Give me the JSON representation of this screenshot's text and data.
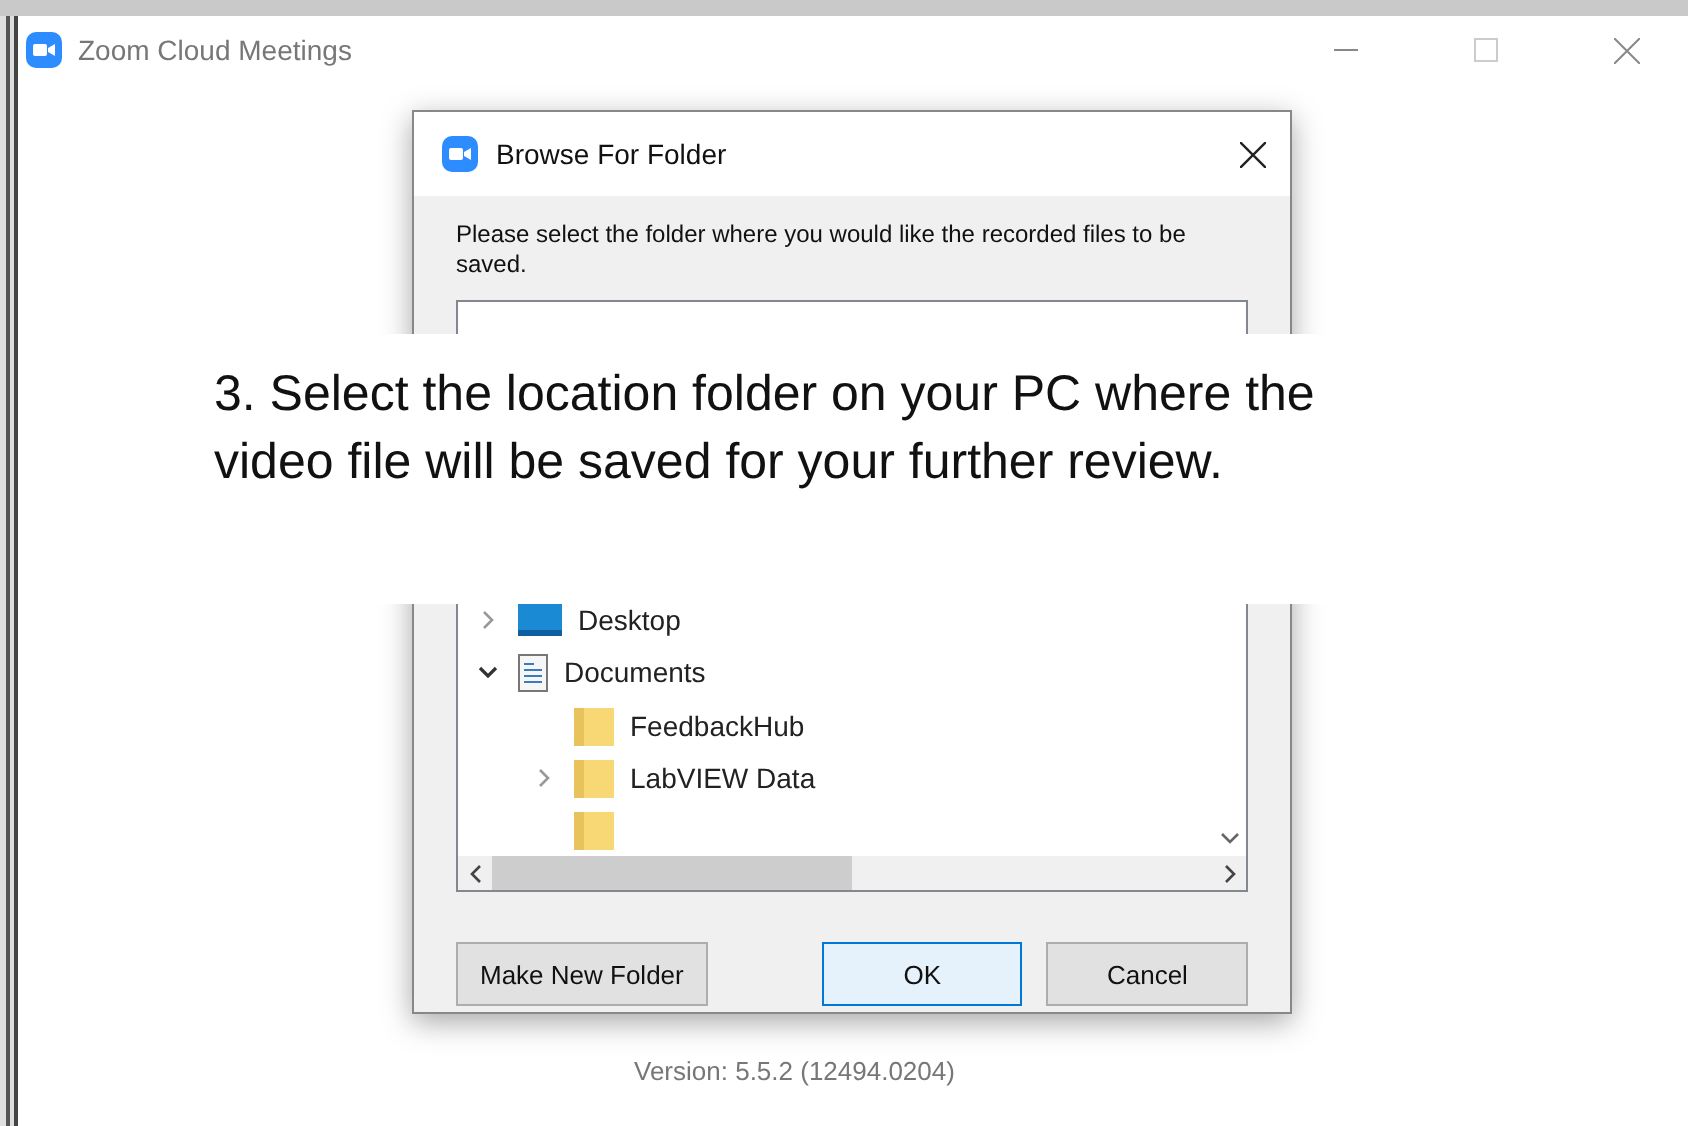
{
  "window": {
    "title": "Zoom Cloud Meetings"
  },
  "dialog": {
    "title": "Browse For Folder",
    "message": "Please select the folder where you would like the recorded files to be saved.",
    "tree": [
      {
        "label": "Desktop",
        "kind": "desktop",
        "expandable": true,
        "expanded": false
      },
      {
        "label": "Documents",
        "kind": "documents",
        "expandable": true,
        "expanded": true,
        "children": [
          {
            "label": "FeedbackHub",
            "kind": "folder",
            "expandable": false
          },
          {
            "label": "LabVIEW Data",
            "kind": "folder",
            "expandable": true,
            "expanded": false
          }
        ]
      }
    ],
    "buttons": [
      {
        "label": "Make New Folder",
        "focused": false
      },
      {
        "label": "OK",
        "focused": true
      },
      {
        "label": "Cancel",
        "focused": false
      }
    ]
  },
  "caption": "3. Select the location folder on your PC where the video file will be saved for your further review.",
  "version": "Version: 5.5.2 (12494.0204)"
}
